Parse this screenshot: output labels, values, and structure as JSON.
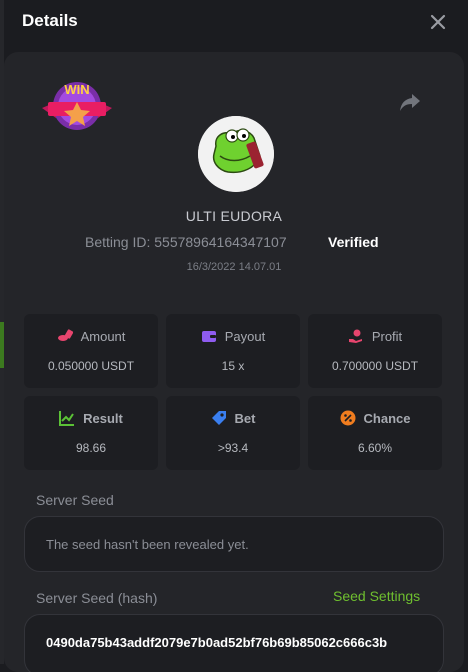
{
  "header": {
    "title": "Details"
  },
  "profile": {
    "badge": "WIN",
    "username": "ULTI EUDORA",
    "betting_id": "Betting ID: 55578964164347107",
    "verified": "Verified",
    "date": "16/3/2022 14.07.01"
  },
  "stats": [
    {
      "label": "Amount",
      "value": "0.050000 USDT",
      "icon": "coins-icon",
      "color": "#e8456e"
    },
    {
      "label": "Payout",
      "value": "15 x",
      "icon": "wallet-icon",
      "color": "#8f5cf0"
    },
    {
      "label": "Profit",
      "value": "0.700000 USDT",
      "icon": "hand-coin-icon",
      "color": "#e8456e"
    },
    {
      "label": "Result",
      "value": "98.66",
      "icon": "chart-icon",
      "color": "#5bc236"
    },
    {
      "label": "Bet",
      "value": ">93.4",
      "icon": "tag-icon",
      "color": "#3a7ff0"
    },
    {
      "label": "Chance",
      "value": "6.60%",
      "icon": "percent-icon",
      "color": "#f07d1f"
    }
  ],
  "server_seed": {
    "label": "Server Seed",
    "value": "The seed hasn't been revealed yet."
  },
  "server_seed_hash": {
    "label": "Server Seed (hash)",
    "settings_link": "Seed Settings",
    "value": "0490da75b43addf2079e7b0ad52bf76b69b85062c666c3b"
  }
}
